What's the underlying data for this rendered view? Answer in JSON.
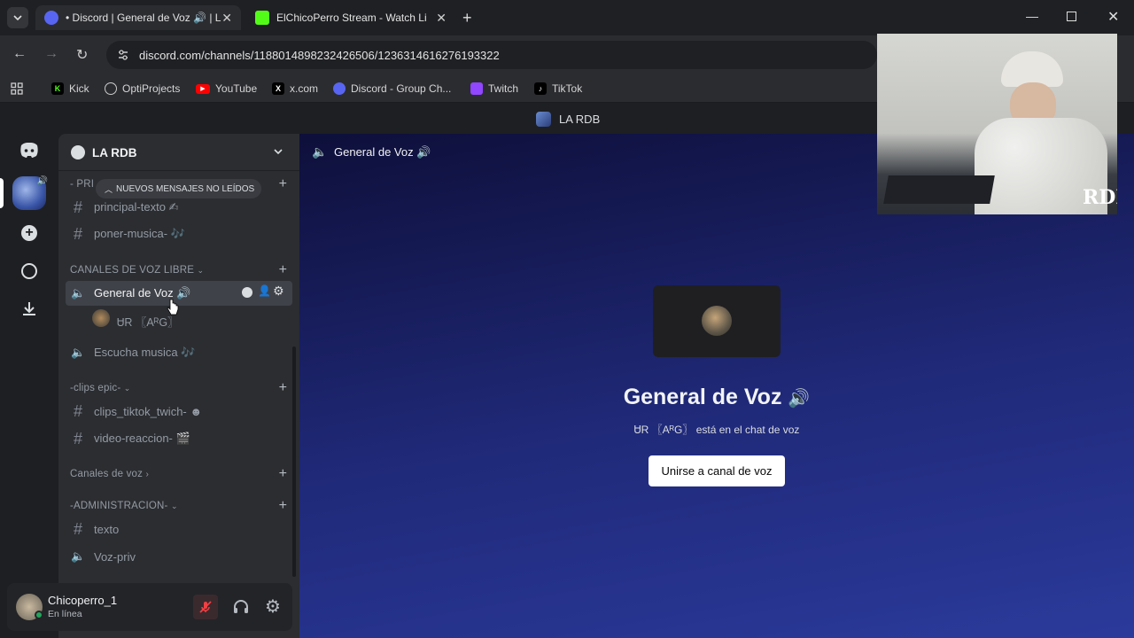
{
  "browser": {
    "tabs": [
      {
        "title": "• Discord | General de Voz 🔊 | L",
        "active": true
      },
      {
        "title": "ElChicoPerro Stream - Watch Li",
        "active": false
      }
    ],
    "url": "discord.com/channels/1188014898232426506/1236314616276193322",
    "bookmarks": [
      "Kick",
      "OptiProjects",
      "YouTube",
      "x.com",
      "Discord - Group Ch...",
      "Twitch",
      "TikTok"
    ]
  },
  "discord": {
    "window_title": "LA RDB",
    "server": {
      "name": "LA RDB"
    },
    "unread_pill": "NUEVOS MENSAJES NO LEÍDOS",
    "categories": {
      "principal": "- PRI",
      "voz_libre": "CANALES DE VOZ LIBRE",
      "clips": "-clips epic-",
      "canales_voz": "Canales de voz",
      "admin": "-ADMINISTRACION-"
    },
    "channels": {
      "principal_texto": "principal-texto ✍",
      "poner_musica": "poner-musica- 🎶",
      "general_voz": "General de Voz 🔊",
      "voice_member": "ᏌR 〖AᴿG〗",
      "escucha_musica": "Escucha musica 🎶",
      "clips_tiktok": "clips_tiktok_twich- ☻",
      "video_reaccion": "video-reaccion- 🎬",
      "texto": "texto",
      "voz_priv": "Voz-priv"
    },
    "header": {
      "channel": "General de Voz 🔊"
    },
    "voice_panel": {
      "title": "General de Voz",
      "subtitle_user": "ᏌR 〖AᴿG〗",
      "subtitle_text": "está en el chat de voz",
      "join_button": "Unirse a canal de voz"
    },
    "user": {
      "name": "Chicoperro_1",
      "status": "En línea"
    }
  },
  "webcam": {
    "overlay_text": "RDB"
  },
  "colors": {
    "accent": "#5865f2",
    "online": "#23a55a",
    "muted": "#f23f43"
  }
}
